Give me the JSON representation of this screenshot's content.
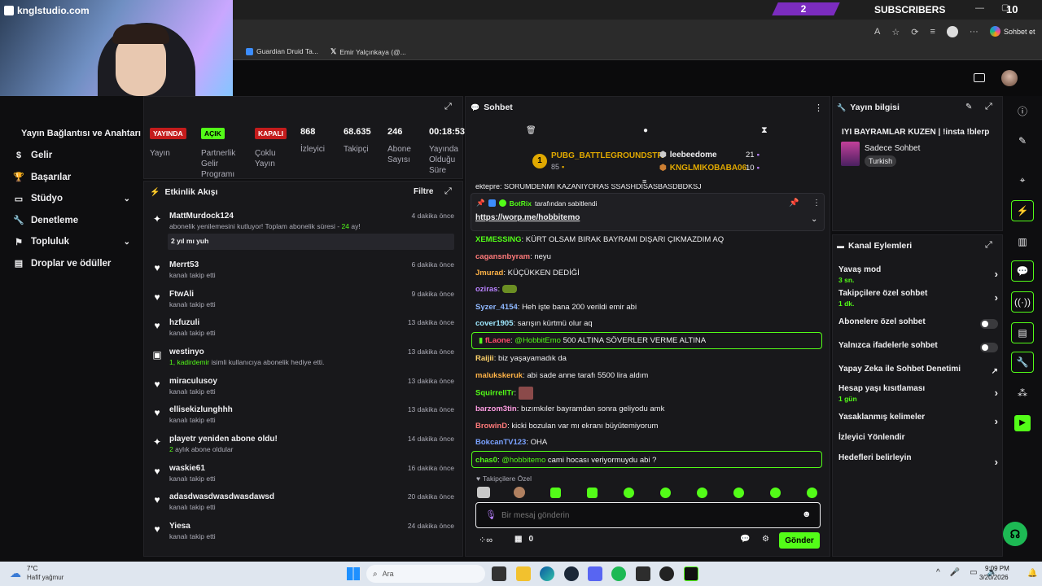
{
  "topbar": {
    "brand": "knglstudio.com",
    "subscribers_count": "2",
    "subscribers_label": "SUBSCRIBERS",
    "top_right_number": "10"
  },
  "browser": {
    "bookmarks": [
      {
        "label": "Guardian Druid Ta..."
      },
      {
        "label": "Emir Yalçınkaya (@..."
      }
    ],
    "copilot_label": "Sohbet et"
  },
  "nav": {
    "partial_title": "Yayın Bağlantısı ve Anahtarı",
    "items": [
      {
        "label": "Gelir",
        "icon": "dollar-icon"
      },
      {
        "label": "Başarılar",
        "icon": "trophy-icon"
      },
      {
        "label": "Stüdyo",
        "icon": "studio-icon",
        "chevron": true
      },
      {
        "label": "Denetleme",
        "icon": "wrench-icon"
      },
      {
        "label": "Topluluk",
        "icon": "community-icon",
        "chevron": true
      },
      {
        "label": "Droplar ve ödüller",
        "icon": "drops-icon"
      }
    ]
  },
  "stream_stats": {
    "badges": [
      "YAYINDA",
      "AÇIK",
      "KAPALI"
    ],
    "items": [
      {
        "label": "Yayın"
      },
      {
        "label": "Partnerlik Gelir Programı"
      },
      {
        "label": "Çoklu Yayın"
      },
      {
        "value": "868",
        "label": "İzleyici"
      },
      {
        "value": "68.635",
        "label": "Takipçi"
      },
      {
        "value": "246",
        "label": "Abone Sayısı"
      },
      {
        "value": "00:18:53",
        "label": "Yayında Olduğu Süre"
      }
    ]
  },
  "activity": {
    "title": "Etkinlik Akışı",
    "filter": "Filtre",
    "items": [
      {
        "name": "MattMurdock124",
        "sub": "abonelik yenilemesini kutluyor! Toplam abonelik süresi - ",
        "sub_highlight": "24",
        "sub_end": " ay!",
        "time": "4 dakika önce",
        "message": "2 yıl mı yuh"
      },
      {
        "name": "Merrt53",
        "sub": "kanalı takip etti",
        "time": "6 dakika önce"
      },
      {
        "name": "FtwAli",
        "sub": "kanalı takip etti",
        "time": "9 dakika önce"
      },
      {
        "name": "hzfuzuli",
        "sub": "kanalı takip etti",
        "time": "13 dakika önce"
      },
      {
        "name": "westinyo",
        "sub_highlight": "1, kadirdemir",
        "sub": " isimli kullanıcıya abonelik hediye etti.",
        "time": "13 dakika önce"
      },
      {
        "name": "miraculusoy",
        "sub": "kanalı takip etti",
        "time": "13 dakika önce"
      },
      {
        "name": "ellisekizlunghhh",
        "sub": "kanalı takip etti",
        "time": "13 dakika önce"
      },
      {
        "name": "playetr yeniden abone oldu!",
        "sub_highlight": "2",
        "sub": " aylık abone oldular",
        "time": "14 dakika önce"
      },
      {
        "name": "waskie61",
        "sub": "kanalı takip etti",
        "time": "16 dakika önce"
      },
      {
        "name": "adasdwasdwasdwasdawsd",
        "sub": "kanalı takip etti",
        "time": "20 dakika önce"
      },
      {
        "name": "Yiesa",
        "sub": "kanalı takip etti",
        "time": "24 dakika önce"
      }
    ]
  },
  "chat": {
    "title": "Sohbet",
    "leaderboard": {
      "top_name": "PUBG_BATTLEGROUNDSTR",
      "top_value": "85",
      "top_rank": "1",
      "second_name": "leebeedome",
      "second_value": "21",
      "third_name": "KNGLMIKOBABA06",
      "third_value": "10"
    },
    "cut_line": "ektepre: SORUMDENMI KAZANIYORAS SSASHDISASBASDBDKSJ",
    "pinned": {
      "by_name": "BotRix",
      "by_text": "tarafından sabitlendi",
      "link": "https://worp.me/hobbitemo"
    },
    "messages": [
      {
        "user": "XEMESSING",
        "color": "#53fc18",
        "text": "KÜRT OLSAM BIRAK BAYRAMI DIŞARI ÇIKMAZDIM AQ"
      },
      {
        "user": "cagansnbyram",
        "color": "#ff7a7a",
        "text": "neyu"
      },
      {
        "user": "Jmurad",
        "color": "#ffb347",
        "text": "KÜÇÜKKEN DEDİĞİ"
      },
      {
        "user": "oziras",
        "color": "#b982ff",
        "text": ""
      },
      {
        "user": "Syzer_4154",
        "color": "#8fb8ff",
        "text": "Heh işte bana 200 verildi emir abi"
      },
      {
        "user": "cover1905",
        "color": "#9ee8ff",
        "text": "sarışın kürtmü olur aq"
      },
      {
        "user": "fLaone",
        "color": "#ff4b6b",
        "mention": "@HobbitEmo",
        "text": "500 ALTINA SÖVERLER VERME ALTINA"
      },
      {
        "user": "Raijii",
        "color": "#ffd36b",
        "text": "biz yaşayamadık da"
      },
      {
        "user": "malukskeruk",
        "color": "#ffb347",
        "text": "abi sade anne tarafı 5500 lira aldım"
      },
      {
        "user": "SquirrellTr",
        "color": "#53fc18",
        "text": ""
      },
      {
        "user": "barzom3tin",
        "color": "#ff9de2",
        "text": "bızımkıler bayramdan sonra geliyodu amk"
      },
      {
        "user": "BrowinD",
        "color": "#ff7a7a",
        "text": "kicki bozulan var mı ekranı büyütemiyorum"
      },
      {
        "user": "BokcanTV123",
        "color": "#7aa2ff",
        "text": "OHA"
      },
      {
        "user": "chas0",
        "color": "#53fc18",
        "mention": "@hobbitemo",
        "text": "cami hocası veriyormuydu abi ?"
      }
    ],
    "followers_label": "Takipçilere Özel",
    "input_placeholder": "Bir mesaj gönderin",
    "points": "0",
    "send_label": "Gönder"
  },
  "stream_info": {
    "title": "Yayın bilgisi",
    "stream_title": "IYI BAYRAMLAR KUZEN | !insta !blerp",
    "category": "Sadece Sohbet",
    "language": "Turkish"
  },
  "channel_actions": {
    "title": "Kanal Eylemleri",
    "items": [
      {
        "label": "Yavaş mod",
        "sub": "3 sn.",
        "control": "chevron"
      },
      {
        "label": "Takipçilere özel sohbet",
        "sub": "1 dk.",
        "control": "chevron"
      },
      {
        "label": "Abonelere özel sohbet",
        "control": "toggle"
      },
      {
        "label": "Yalnızca ifadelerle sohbet",
        "control": "toggle"
      },
      {
        "label": "Yapay Zeka ile Sohbet Denetimi",
        "control": "external"
      },
      {
        "label": "Hesap yaşı kısıtlaması",
        "sub": "1 gün",
        "control": "chevron"
      },
      {
        "label": "Yasaklanmış kelimeler",
        "control": "chevron"
      },
      {
        "label": "İzleyici Yönlendir",
        "control": "none"
      },
      {
        "label": "Hedefleri belirleyin",
        "control": "chevron"
      }
    ]
  },
  "taskbar": {
    "weather_temp": "7°C",
    "weather_desc": "Hafif yağmur",
    "search": "Ara",
    "time": "9:09 PM",
    "date": "3/20/2026"
  },
  "colors": {
    "accent": "#53fc18",
    "panel": "#18181b",
    "background": "#0e0e10"
  }
}
